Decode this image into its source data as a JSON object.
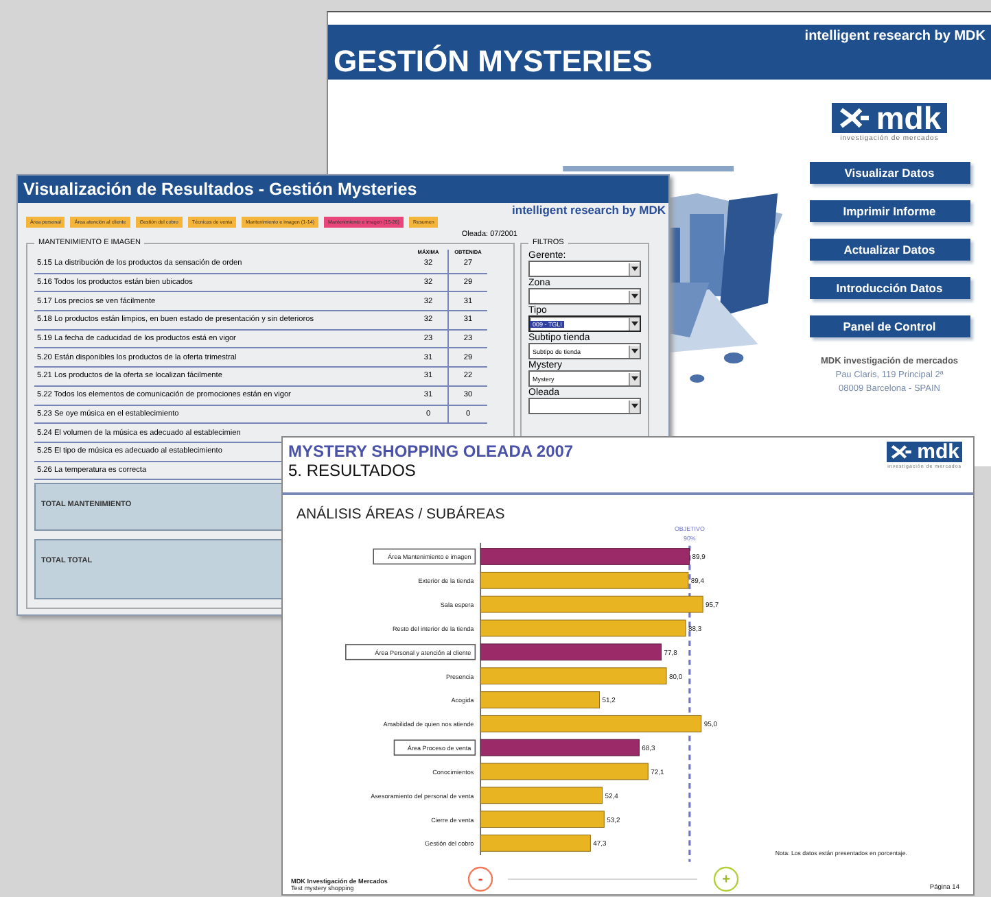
{
  "back_window": {
    "brand": "intelligent research by MDK",
    "title": "GESTIÓN MYSTERIES",
    "logo": {
      "wordmark": "mdk",
      "tagline": "investigación de mercados"
    },
    "menu_buttons": [
      "Visualizar Datos",
      "Imprimir Informe",
      "Actualizar Datos",
      "Introducción Datos",
      "Panel de Control"
    ],
    "company": "MDK investigación de mercados",
    "address": [
      "Pau Claris, 119 Principal 2ª",
      "08009 Barcelona - SPAIN"
    ]
  },
  "results_window": {
    "title": "Visualización de Resultados - Gestión Mysteries",
    "brand": "intelligent research by MDK",
    "tabs": [
      {
        "label": "Área personal",
        "selected": false
      },
      {
        "label": "Área atención al cliente",
        "selected": false
      },
      {
        "label": "Gestión del cobro",
        "selected": false
      },
      {
        "label": "Técnicas de venta",
        "selected": false
      },
      {
        "label": "Mantenimiento e imagen (1-14)",
        "selected": false
      },
      {
        "label": "Mantenimiento e imagen (15-26)",
        "selected": true
      },
      {
        "label": "Resumen",
        "selected": false
      }
    ],
    "wave": "Oleada: 07/2001",
    "section": "MANTENIMIENTO E IMAGEN",
    "columns": [
      "MÁXIMA",
      "OBTENIDA"
    ],
    "rows": [
      {
        "text": "5.15 La distribución de los productos da sensación de orden",
        "max": "32",
        "obtained": "27"
      },
      {
        "text": "5.16 Todos los productos están bien ubicados",
        "max": "32",
        "obtained": "29"
      },
      {
        "text": "5.17 Los precios se ven fácilmente",
        "max": "32",
        "obtained": "31"
      },
      {
        "text": "5.18 Lo productos están limpios, en buen estado de presentación y sin deterioros",
        "max": "32",
        "obtained": "31"
      },
      {
        "text": "5.19 La fecha de caducidad de los productos está en vigor",
        "max": "23",
        "obtained": "23"
      },
      {
        "text": "5.20 Están disponibles los productos de la oferta trimestral",
        "max": "31",
        "obtained": "29"
      },
      {
        "text": "5.21 Los productos de la oferta se localizan fácilmente",
        "max": "31",
        "obtained": "22"
      },
      {
        "text": "5.22 Todos los elementos de comunicación de promociones están en vigor",
        "max": "31",
        "obtained": "30"
      },
      {
        "text": "5.23 Se oye música en el establecimiento",
        "max": "0",
        "obtained": "0"
      },
      {
        "text": "5.24 El volumen de la música es adecuado al establecimien"
      },
      {
        "text": "5.25 El tipo de música es adecuado al establecimiento"
      },
      {
        "text": "5.26 La temperatura es correcta"
      }
    ],
    "totals": [
      "TOTAL MANTENIMIENTO",
      "TOTAL TOTAL"
    ],
    "filters": {
      "title": "FILTROS",
      "fields": [
        {
          "label": "Gerente:",
          "highlighted": false
        },
        {
          "label": "Zona",
          "highlighted": false
        },
        {
          "label": "Tipo",
          "value": "009 - TGLI",
          "highlighted": true
        },
        {
          "label": "Subtipo tienda",
          "value": "Subtipo de tienda",
          "highlighted": false
        },
        {
          "label": "Mystery",
          "value": "Mystery",
          "highlighted": false
        },
        {
          "label": "Oleada",
          "highlighted": false
        }
      ]
    }
  },
  "report": {
    "title": "MYSTERY SHOPPING OLEADA 2007",
    "subtitle": "5. RESULTADOS",
    "logo": {
      "wordmark": "mdk",
      "tagline": "investigación de mercados"
    },
    "heading": "ANÁLISIS ÁREAS / SUBÁREAS",
    "chart_data": {
      "type": "bar",
      "orientation": "horizontal",
      "categories": [
        "Área Mantenimiento e imagen",
        "Exterior de la tienda",
        "Sala espera",
        "Resto del interior de la tienda",
        "Área Personal y atención al cliente",
        "Presencia",
        "Acogida",
        "Amabilidad de quien nos atiende",
        "Área Proceso de venta",
        "Conocimientos",
        "Asesoramiento del personal de venta",
        "Cierre de venta",
        "Gestión del cobro"
      ],
      "series": [
        {
          "color": "#9b2a68",
          "values": [
            89.9,
            null,
            null,
            null,
            77.8,
            null,
            null,
            null,
            68.3,
            null,
            null,
            null,
            null
          ],
          "value_labels": [
            "89,9",
            null,
            null,
            null,
            "77,8",
            null,
            null,
            null,
            "68,3",
            null,
            null,
            null,
            null
          ]
        },
        {
          "color": "#e8b422",
          "values": [
            null,
            89.4,
            95.7,
            88.3,
            null,
            80.0,
            51.2,
            95.0,
            null,
            72.1,
            52.4,
            53.2,
            47.3
          ],
          "value_labels": [
            null,
            "89,4",
            "95,7",
            "88,3",
            null,
            "80,0",
            "51,2",
            "95,0",
            null,
            "72,1",
            "52,4",
            "53,2",
            "47,3"
          ]
        }
      ],
      "ref_lines": [
        {
          "axis": "x",
          "value": 90,
          "label": "OBJETIVO 90%"
        }
      ]
    },
    "scale": {
      "low": "-",
      "high": "+"
    },
    "note": "Nota: Los datos están presentados en porcentaje.",
    "footer": [
      "MDK Investigación de Mercados",
      "Test mystery shopping"
    ],
    "page": "Página 14"
  }
}
